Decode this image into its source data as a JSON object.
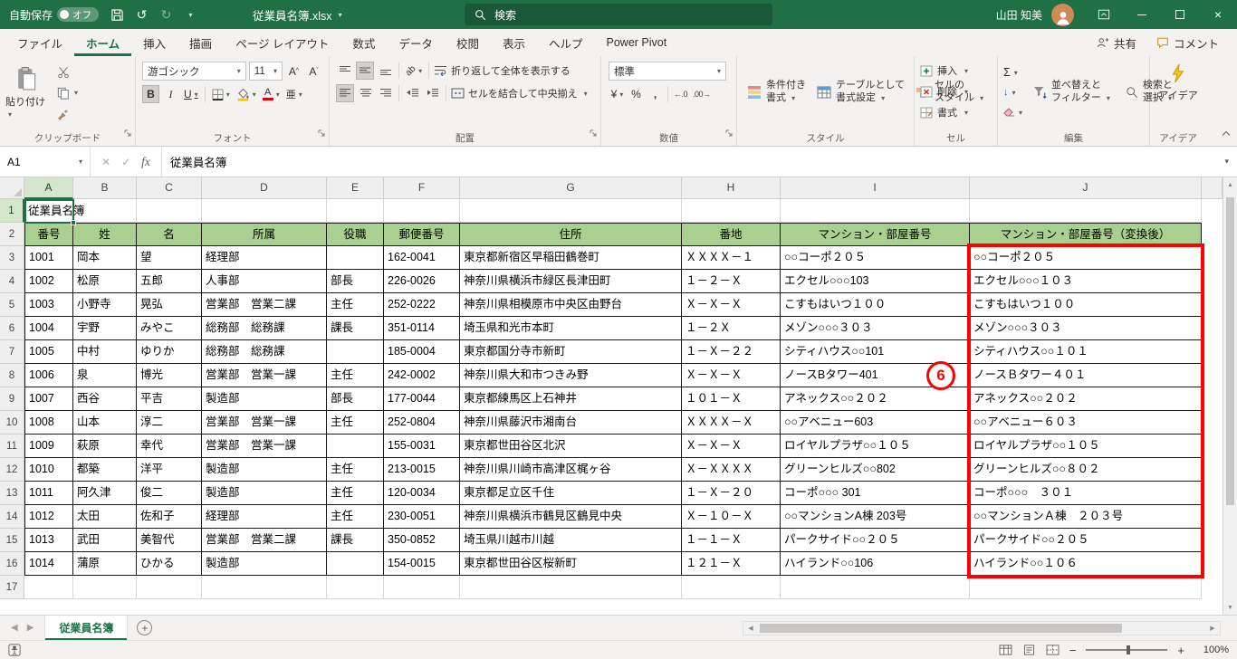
{
  "title_bar": {
    "autosave_label": "自動保存",
    "autosave_state": "オフ",
    "filename": "従業員名簿.xlsx",
    "search_label": "検索",
    "user_name": "山田 知美"
  },
  "ribbon": {
    "tabs": [
      "ファイル",
      "ホーム",
      "挿入",
      "描画",
      "ページ レイアウト",
      "数式",
      "データ",
      "校閲",
      "表示",
      "ヘルプ",
      "Power Pivot"
    ],
    "active_tab_index": 1,
    "share_label": "共有",
    "comments_label": "コメント",
    "clipboard": {
      "paste": "貼り付け"
    },
    "font": {
      "name": "游ゴシック",
      "size": "11",
      "phonetic": "亜"
    },
    "alignment": {
      "wrap": "折り返して全体を表示する",
      "merge": "セルを結合して中央揃え"
    },
    "number": {
      "format": "標準",
      "currency": "¥",
      "percent": "%",
      "comma": ",",
      "dec_inc": "←.0",
      "dec_dec": ".00→"
    },
    "styles_buttons": [
      [
        "条件付き",
        "書式"
      ],
      [
        "テーブルとして",
        "書式設定"
      ],
      [
        "セルの",
        "スタイル"
      ]
    ],
    "cells_buttons": [
      "挿入",
      "削除",
      "書式"
    ],
    "editing": {
      "autosum": "Σ",
      "sort1": "並べ替えと",
      "sort2": "フィルター",
      "find1": "検索と",
      "find2": "選択"
    },
    "ideas_label": "アイデア",
    "group_labels": [
      "クリップボード",
      "フォント",
      "配置",
      "数値",
      "スタイル",
      "セル",
      "編集",
      "アイデア"
    ]
  },
  "formula_bar": {
    "name_box": "A1",
    "fx": "fx",
    "formula": "従業員名簿"
  },
  "sheet": {
    "column_letters": [
      "A",
      "B",
      "C",
      "D",
      "E",
      "F",
      "G",
      "H",
      "I",
      "J"
    ],
    "row_count": 17,
    "a1": "従業員名簿",
    "header_row": [
      "番号",
      "姓",
      "名",
      "所属",
      "役職",
      "郵便番号",
      "住所",
      "番地",
      "マンション・部屋番号",
      "マンション・部屋番号（変換後）"
    ],
    "data_rows": [
      [
        "1001",
        "岡本",
        "望",
        "経理部",
        "",
        "162-0041",
        "東京都新宿区早稲田鶴巻町",
        "ＸＸＸＸ－１",
        "○○コーポ２０５",
        "○○コーポ２０５"
      ],
      [
        "1002",
        "松原",
        "五郎",
        "人事部",
        "部長",
        "226-0026",
        "神奈川県横浜市緑区長津田町",
        "１－２－Ｘ",
        "エクセル○○○103",
        "エクセル○○○１０３"
      ],
      [
        "1003",
        "小野寺",
        "晃弘",
        "営業部　営業二課",
        "主任",
        "252-0222",
        "神奈川県相模原市中央区由野台",
        "Ｘ－Ｘ－Ｘ",
        "こすもはいつ１００",
        "こすもはいつ１００"
      ],
      [
        "1004",
        "宇野",
        "みやこ",
        "総務部　総務課",
        "課長",
        "351-0114",
        "埼玉県和光市本町",
        "１－２Ｘ",
        "メゾン○○○３０３",
        "メゾン○○○３０３"
      ],
      [
        "1005",
        "中村",
        "ゆりか",
        "総務部　総務課",
        "",
        "185-0004",
        "東京都国分寺市新町",
        "１－Ｘ－２２",
        "シティハウス○○101",
        "シティハウス○○１０１"
      ],
      [
        "1006",
        "泉",
        "博光",
        "営業部　営業一課",
        "主任",
        "242-0002",
        "神奈川県大和市つきみ野",
        "Ｘ－Ｘ－Ｘ",
        "ノースBタワー401",
        "ノースＢタワー４０１"
      ],
      [
        "1007",
        "西谷",
        "平吉",
        "製造部",
        "部長",
        "177-0044",
        "東京都練馬区上石神井",
        "１０１－Ｘ",
        "アネックス○○２０２",
        "アネックス○○２０２"
      ],
      [
        "1008",
        "山本",
        "淳二",
        "営業部　営業一課",
        "主任",
        "252-0804",
        "神奈川県藤沢市湘南台",
        "ＸＸＸＸ－Ｘ",
        "○○アベニュー603",
        "○○アベニュー６０３"
      ],
      [
        "1009",
        "萩原",
        "幸代",
        "営業部　営業一課",
        "",
        "155-0031",
        "東京都世田谷区北沢",
        "Ｘ－Ｘ－Ｘ",
        "ロイヤルプラザ○○１０５",
        "ロイヤルプラザ○○１０５"
      ],
      [
        "1010",
        "都築",
        "洋平",
        "製造部",
        "主任",
        "213-0015",
        "神奈川県川崎市高津区梶ヶ谷",
        "Ｘ－ＸＸＸＸ",
        "グリーンヒルズ○○802",
        "グリーンヒルズ○○８０２"
      ],
      [
        "1011",
        "阿久津",
        "俊二",
        "製造部",
        "主任",
        "120-0034",
        "東京都足立区千住",
        "１－Ｘ－２０",
        "コーポ○○○ 301",
        "コーポ○○○　３０１"
      ],
      [
        "1012",
        "太田",
        "佐和子",
        "経理部",
        "主任",
        "230-0051",
        "神奈川県横浜市鶴見区鶴見中央",
        "Ｘ－１０－Ｘ",
        "○○マンションA棟 203号",
        "○○マンションＡ棟　２０３号"
      ],
      [
        "1013",
        "武田",
        "美智代",
        "営業部　営業二課",
        "課長",
        "350-0852",
        "埼玉県川越市川越",
        "１－１－Ｘ",
        "パークサイド○○２０５",
        "パークサイド○○２０５"
      ],
      [
        "1014",
        "蒲原",
        "ひかる",
        "製造部",
        "",
        "154-0015",
        "東京都世田谷区桜新町",
        "１２１－Ｘ",
        "ハイランド○○106",
        "ハイランド○○１０６"
      ]
    ]
  },
  "annotation_number": "6",
  "sheet_tabs": {
    "active": "従業員名簿"
  },
  "status_bar": {
    "zoom": "100%"
  }
}
